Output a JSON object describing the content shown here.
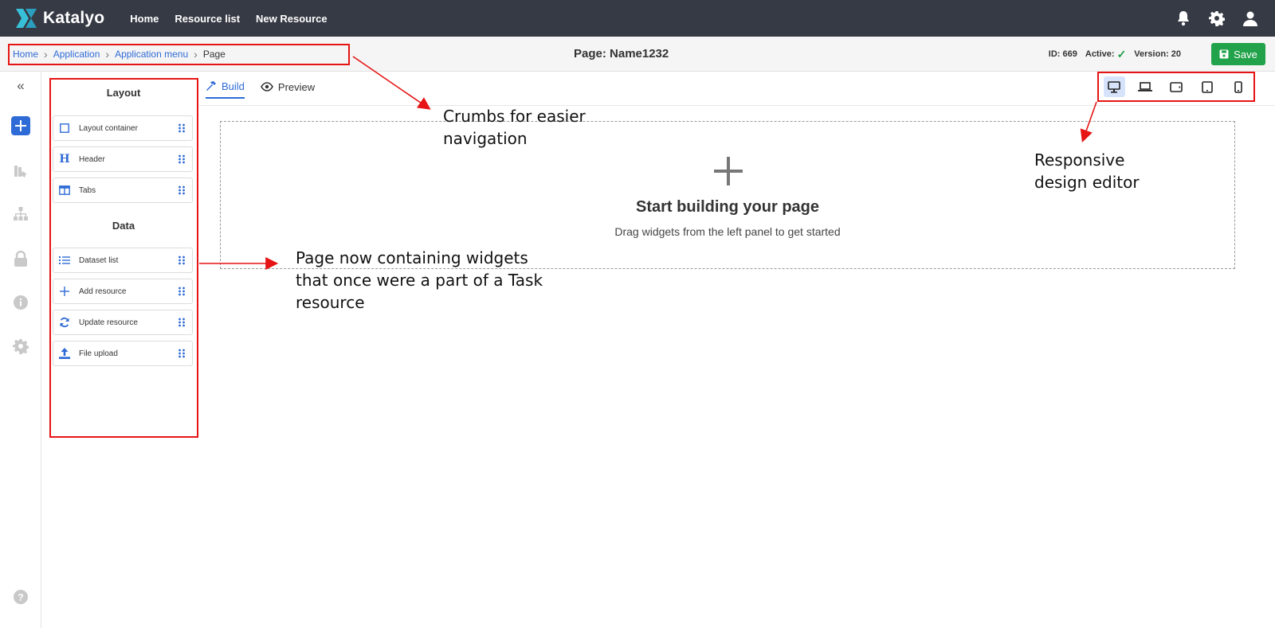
{
  "navbar": {
    "brand": "Katalyo",
    "links": [
      "Home",
      "Resource list",
      "New Resource"
    ]
  },
  "breadcrumb": {
    "items": [
      "Home",
      "Application",
      "Application menu"
    ],
    "current": "Page"
  },
  "page": {
    "title": "Page: Name1232",
    "id_text": "ID: 669",
    "active_label": "Active:",
    "version_text": "Version: 20",
    "save_label": "Save"
  },
  "widgets_panel": {
    "layout_heading": "Layout",
    "layout_items": [
      "Layout container",
      "Header",
      "Tabs"
    ],
    "data_heading": "Data",
    "data_items": [
      "Dataset list",
      "Add resource",
      "Update resource",
      "File upload"
    ]
  },
  "build_tabs": {
    "build": "Build",
    "preview": "Preview"
  },
  "devices": [
    "desktop-icon",
    "laptop-icon",
    "tablet-landscape-icon",
    "tablet-icon",
    "mobile-icon"
  ],
  "dropzone": {
    "title": "Start building your page",
    "subtitle": "Drag widgets from the left panel to get started"
  },
  "annotations": {
    "crumbs_line1": "Crumbs for easier",
    "crumbs_line2": "navigation",
    "responsive_line1": "Responsive",
    "responsive_line2": "design editor",
    "widgets_line1": "Page now containing widgets",
    "widgets_line2": "that once were a part of a Task",
    "widgets_line3": "resource"
  },
  "colors": {
    "navbar": "#363a45",
    "accent": "#2f6bd6",
    "save": "#22a24a",
    "annotation": "#e61414"
  }
}
